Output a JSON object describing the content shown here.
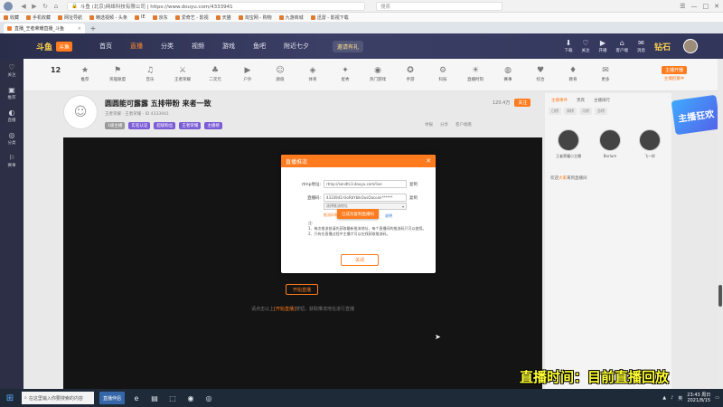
{
  "browser": {
    "address": "斗鱼 (北京)网络科技有限公司 | https://www.douyu.com/4333941",
    "search_placeholder": "搜索",
    "tab_title": "直播_王者荣耀直播_斗鱼",
    "bookmarks": [
      "收藏",
      "手机收藏",
      "网址导航",
      "精选视频 - 头条",
      "IE",
      "京东",
      "爱奇艺 - 影视",
      "天猫",
      "淘宝网 - 购物",
      "九游商城",
      "迅雷 - 影视下载"
    ]
  },
  "header": {
    "logo": "斗鱼",
    "logo_badge": "斗鱼",
    "nav": [
      "首页",
      "直播",
      "分类",
      "视频",
      "游戏",
      "鱼吧",
      "附近七夕"
    ],
    "promo": "邀请有礼",
    "right_icons": [
      {
        "glyph": "⬇",
        "label": "下载"
      },
      {
        "glyph": "♡",
        "label": "关注"
      },
      {
        "glyph": "▶",
        "label": "开播"
      },
      {
        "glyph": "⌂",
        "label": "客户端"
      },
      {
        "glyph": "✉",
        "label": "消息"
      }
    ],
    "brand": "钻石"
  },
  "sidebar": [
    {
      "glyph": "♡",
      "label": "关注"
    },
    {
      "glyph": "▣",
      "label": "推荐"
    },
    {
      "glyph": "◐",
      "label": "直播"
    },
    {
      "glyph": "◎",
      "label": "分类"
    },
    {
      "glyph": "⚐",
      "label": "赛事"
    }
  ],
  "categories": {
    "rank": "12",
    "items": [
      {
        "glyph": "★",
        "label": "推荐",
        "badge": ""
      },
      {
        "glyph": "⚑",
        "label": "英雄联盟",
        "badge": ""
      },
      {
        "glyph": "♫",
        "label": "音乐",
        "badge": ""
      },
      {
        "glyph": "⚔",
        "label": "王者荣耀",
        "badge": ""
      },
      {
        "glyph": "♣",
        "label": "二次元",
        "badge": ""
      },
      {
        "glyph": "▶",
        "label": "户外",
        "badge": ""
      },
      {
        "glyph": "☺",
        "label": "颜值",
        "badge": ""
      },
      {
        "glyph": "◈",
        "label": "体育",
        "badge": ""
      },
      {
        "glyph": "✦",
        "label": "星秀",
        "badge": ""
      },
      {
        "glyph": "◉",
        "label": "热门游戏",
        "badge": ""
      },
      {
        "glyph": "✪",
        "label": "手游",
        "badge": ""
      },
      {
        "glyph": "⚙",
        "label": "科技",
        "badge": ""
      },
      {
        "glyph": "☀",
        "label": "直播时刻",
        "badge": ""
      },
      {
        "glyph": "◍",
        "label": "赛事",
        "badge": ""
      },
      {
        "glyph": "♥",
        "label": "综合",
        "badge": ""
      },
      {
        "glyph": "♦",
        "label": "教育",
        "badge": ""
      },
      {
        "glyph": "✉",
        "label": "更多",
        "badge": ""
      }
    ],
    "right_button": "主播开播",
    "right_sub": "主播招募中"
  },
  "room": {
    "title": "圆圆能可露露 五排带粉 来者一致",
    "meta": "王者荣耀   ·   王者荣耀   ·   ID 4333941",
    "tags": [
      "1级主播",
      "实名认证",
      "超级粉丝",
      "王者荣耀",
      "主播榜"
    ],
    "report_items": [
      "举报",
      "分享",
      "客户端看"
    ],
    "fans_count": "120.4万",
    "follow_label": "关注"
  },
  "player": {
    "stream_button": "开始直播",
    "hint_prefix": "请点击以上",
    "hint_highlight": "[开始直播]",
    "hint_suffix": "按钮，获取推流地址进行直播"
  },
  "modal": {
    "title": "直播推流",
    "rtmp_label": "rtmp地址:",
    "rtmp_value": "rtmp://sendtc3.douyu.com/live",
    "code_label": "直播码:",
    "code_value": "4333941rUoRbYblkOusOacoini******",
    "copy_label": "复制",
    "select_value": "选择推流地址",
    "popup_label": "已成功复制直播码",
    "gen_note": "推流码有效期",
    "gen_link": "说明",
    "notes": [
      "注:",
      "1、每次推流前请先获取最新推流地址，每个直播间的推流码只可以使用。",
      "2、只有在直播过程中主播才可以在线获取推流码。"
    ],
    "close_button": "关闭"
  },
  "right_panel": {
    "tabs": [
      "主播事件",
      "贵宾",
      "主播排行"
    ],
    "subtabs": [
      "日榜",
      "周榜",
      "月榜",
      "总榜"
    ],
    "users": [
      {
        "name": "王者荣耀小主播"
      },
      {
        "name": "Borlum"
      },
      {
        "name": "飞一样"
      }
    ],
    "gift_prefix": "欢迎",
    "gift_highlight": "大家",
    "gift_suffix": "来到直播间"
  },
  "side_badge": "主播狂欢",
  "overlay_text": "直播时间：目前直播回放",
  "taskbar": {
    "search": "在这里输入你要搜索的内容",
    "highlight_app": "直播伴侣",
    "apps": [
      "e",
      "▤",
      "⬚",
      "◉",
      "◎"
    ],
    "tray_text": "英",
    "time": "23:43 周日",
    "date": "2021/8/15"
  }
}
